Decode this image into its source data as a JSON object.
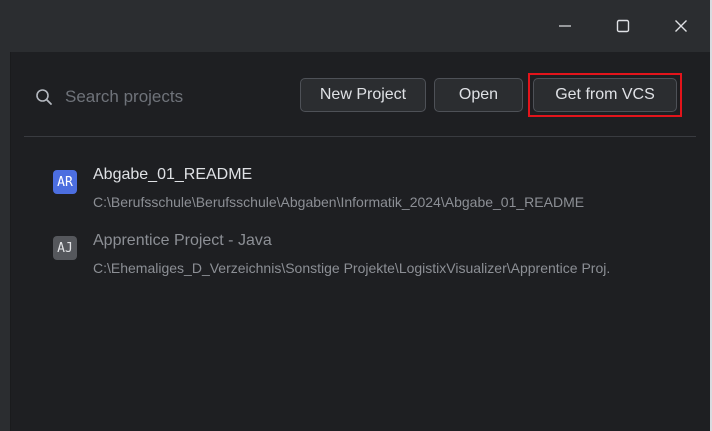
{
  "window_controls": {
    "minimize_icon": "minimize-icon",
    "maximize_icon": "maximize-icon",
    "close_icon": "close-icon"
  },
  "search": {
    "placeholder": "Search projects",
    "value": ""
  },
  "toolbar": {
    "new_project_label": "New Project",
    "open_label": "Open",
    "get_from_vcs_label": "Get from VCS"
  },
  "projects": [
    {
      "badge": "AR",
      "badge_color": "#4c6ee0",
      "name": "Abgabe_01_README",
      "path": "C:\\Berufsschule\\Berufsschule\\Abgaben\\Informatik_2024\\Abgabe_01_README"
    },
    {
      "badge": "AJ",
      "badge_color": "#55575c",
      "name": "Apprentice Project - Java",
      "path": "C:\\Ehemaliges_D_Verzeichnis\\Sonstige Projekte\\LogistixVisualizer\\Apprentice Proj."
    }
  ],
  "colors": {
    "background": "#1e1f22",
    "panel": "#2b2d30",
    "highlight": "#e3141b"
  }
}
